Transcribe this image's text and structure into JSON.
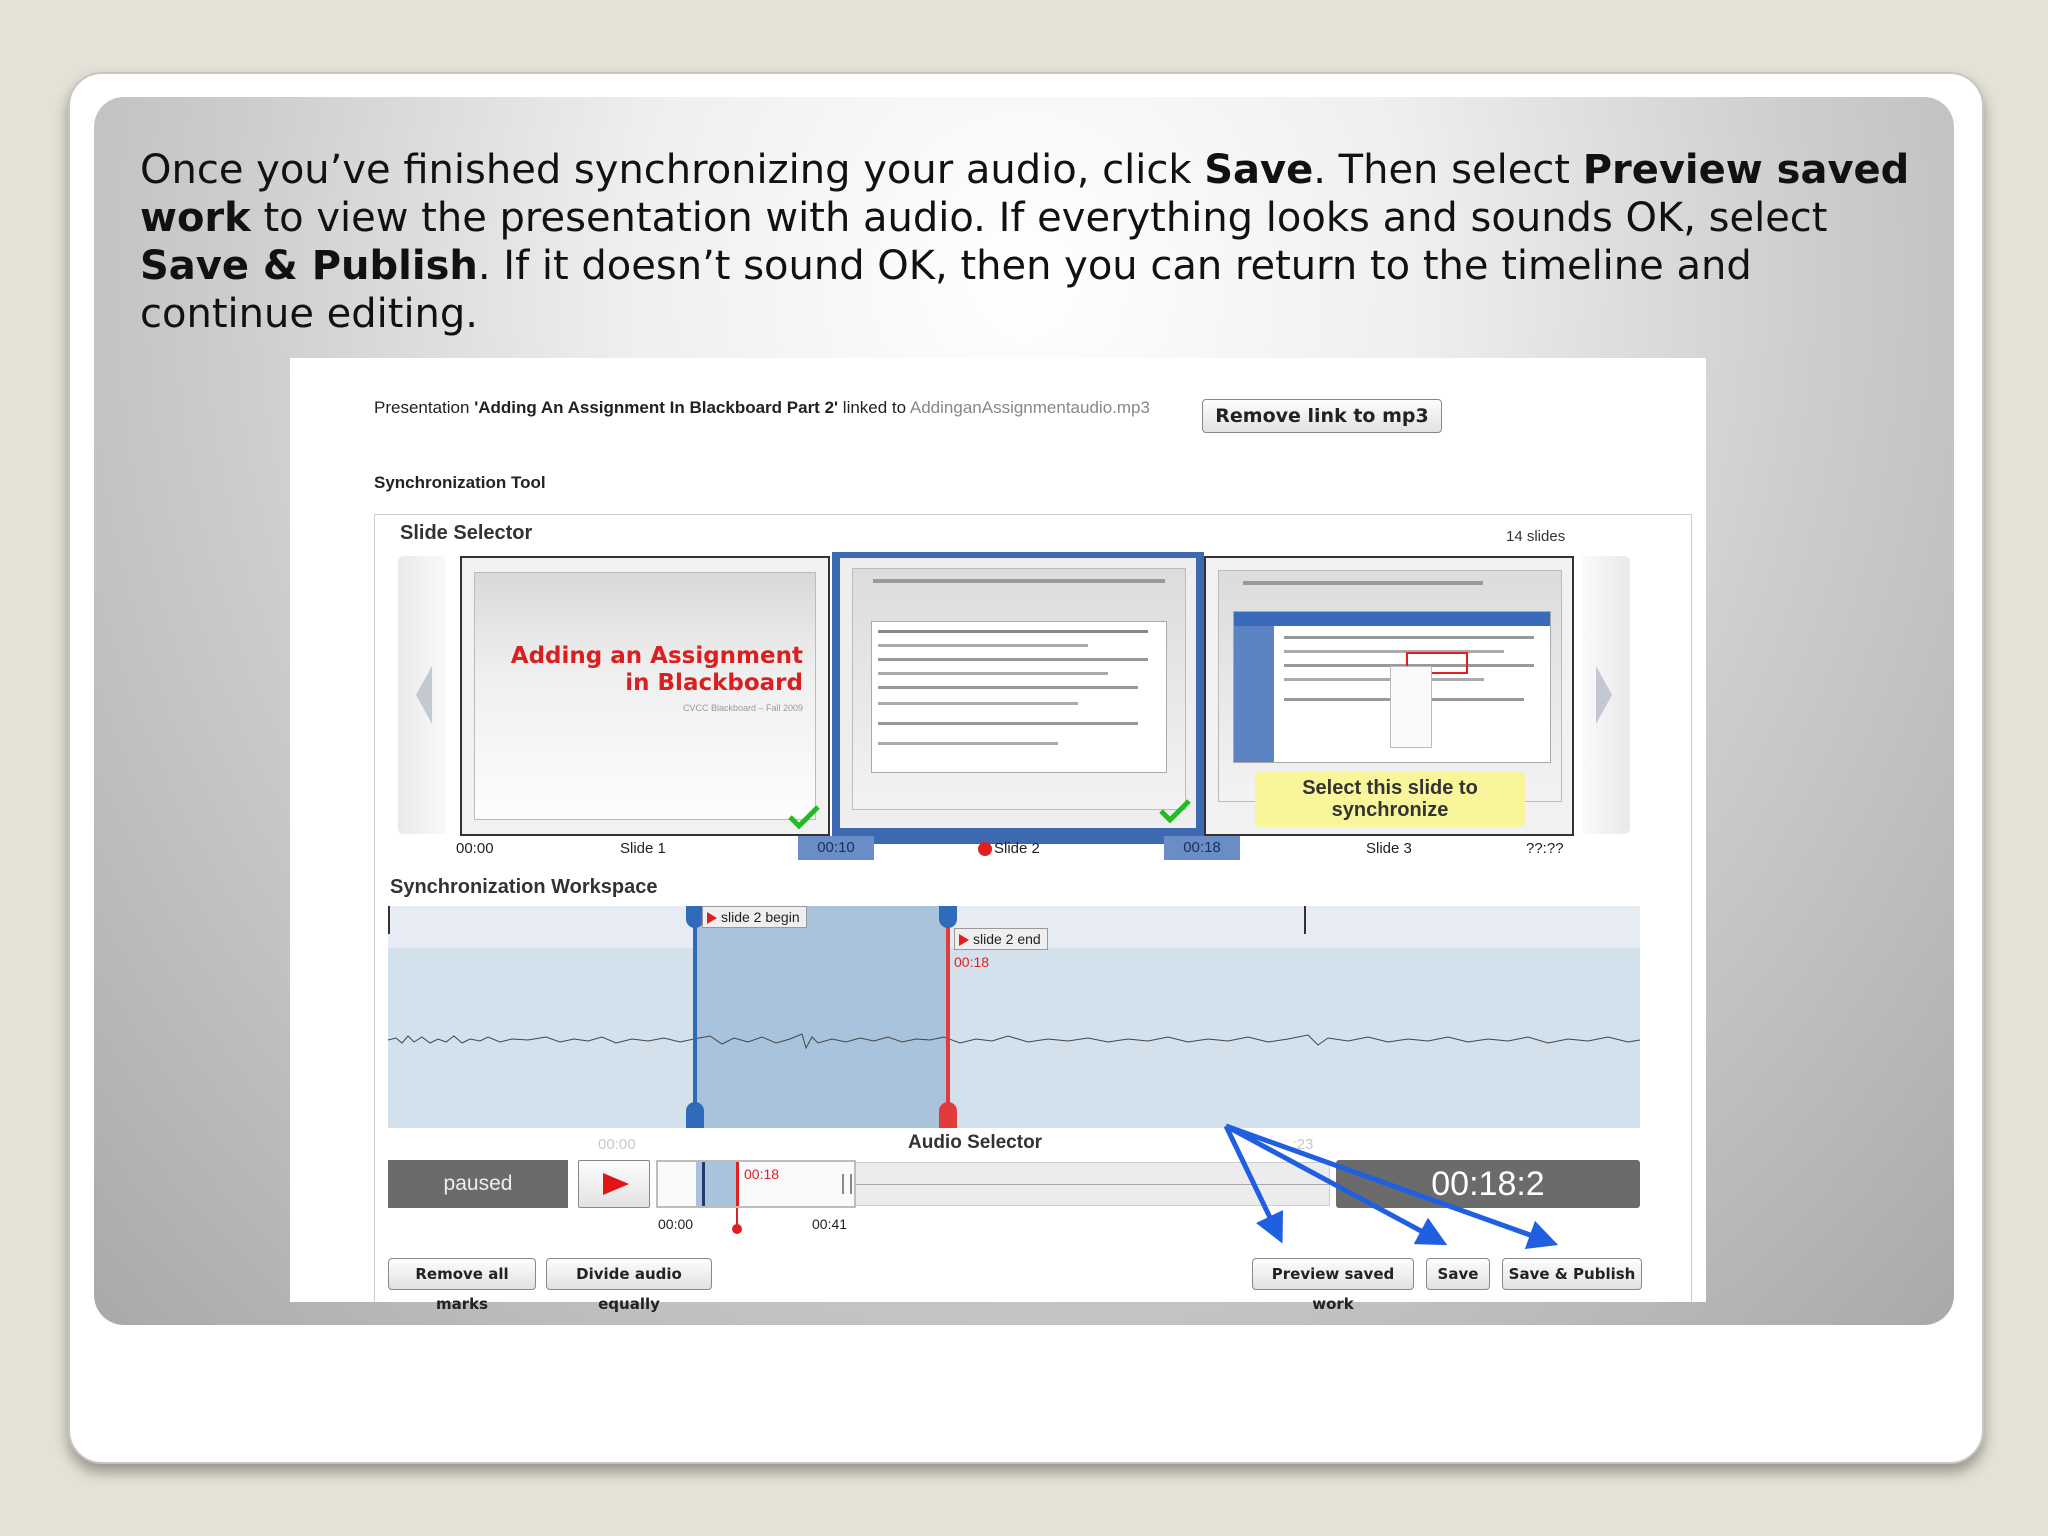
{
  "intro": {
    "p1": "Once you’ve finished synchronizing your audio, click ",
    "b1": "Save",
    "p2": ".  Then select ",
    "b2": "Preview saved work",
    "p3": " to view the presentation with audio.  If everything looks and sounds OK, select ",
    "b3": "Save & Publish",
    "p4": ".  If it doesn’t sound OK, then you can return to the timeline and continue editing."
  },
  "presentation": {
    "prefix": "Presentation ",
    "title": "'Adding An Assignment In Blackboard Part 2'",
    "linked": " linked to ",
    "file": "AddinganAssignmentaudio.mp3",
    "remove_button": "Remove link to mp3"
  },
  "sync_tool_title": "Synchronization Tool",
  "slide_selector": {
    "title": "Slide Selector",
    "count": "14 slides",
    "slide1_title_line1": "Adding an Assignment",
    "slide1_title_line2": "in Blackboard",
    "slide1_subtitle": "CVCC Blackboard – Fall 2009",
    "slide3_tooltip": "Select this slide to synchronize",
    "times": [
      "00:00",
      "00:10",
      "00:18",
      "??:??"
    ],
    "labels": [
      "Slide 1",
      "Slide 2",
      "Slide 3"
    ]
  },
  "workspace": {
    "title": "Synchronization Workspace",
    "begin_flag": "slide    2 begin",
    "end_flag": "slide  2    end",
    "end_time": "00:18"
  },
  "audio_selector": {
    "title": "Audio Selector",
    "status": "paused",
    "faded_start": "00:00",
    "faded_end": "...:23",
    "cursor_time": "00:18",
    "range_start": "00:00",
    "range_end": "00:41",
    "timer": "00:18:2"
  },
  "buttons": {
    "remove_all_marks": "Remove all marks",
    "divide_audio": "Divide audio equally",
    "preview": "Preview saved work",
    "save": "Save",
    "save_publish": "Save & Publish"
  },
  "colors": {
    "accent_blue": "#1f5fe0",
    "marker_red": "#e53a3a",
    "check_green": "#22bb22"
  }
}
